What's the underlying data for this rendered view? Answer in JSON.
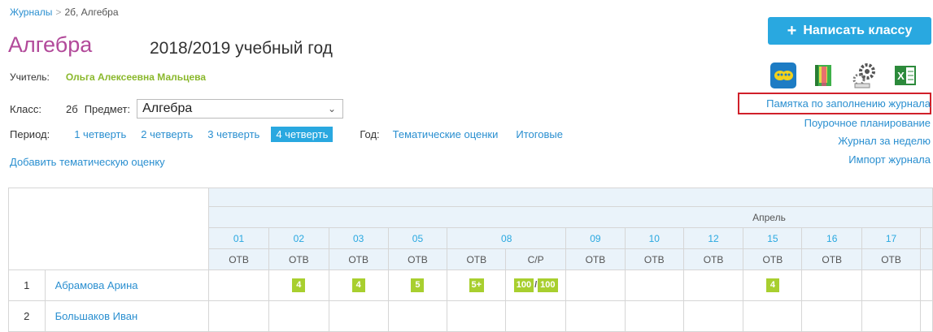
{
  "breadcrumb": {
    "parent": "Журналы",
    "separator": ">",
    "current": "2б, Алгебра"
  },
  "title": {
    "subject": "Алгебра",
    "year": "2018/2019 учебный год"
  },
  "teacher": {
    "label": "Учитель:",
    "name": "Ольга Алексеевна Мальцева"
  },
  "class_row": {
    "class_label": "Класс:",
    "class_value": "2б",
    "subject_label": "Предмет:",
    "subject_value": "Алгебра"
  },
  "period": {
    "label": "Период:",
    "options": [
      "1 четверть",
      "2 четверть",
      "3 четверть",
      "4 четверть"
    ],
    "active_index": 3,
    "year_label": "Год:",
    "year_options": [
      "Тематические оценки",
      "Итоговые"
    ]
  },
  "add_thematic": "Добавить тематическую оценку",
  "write_button": {
    "icon": "+",
    "label": "Написать классу"
  },
  "toolbar_icons": [
    "chat-icon",
    "book-icon",
    "gears-icon",
    "excel-icon",
    "printer-icon"
  ],
  "right_links": [
    "Памятка по заполнению журнала",
    "Поурочное планирование",
    "Журнал за неделю",
    "Импорт журнала"
  ],
  "table": {
    "month": "Апрель",
    "dates": [
      "01",
      "02",
      "03",
      "05",
      "08",
      "09",
      "10",
      "12",
      "15",
      "16",
      "17"
    ],
    "work_types": [
      "ОТВ",
      "ОТВ",
      "ОТВ",
      "ОТВ",
      "ОТВ",
      "С/Р",
      "ОТВ",
      "ОТВ",
      "ОТВ",
      "ОТВ",
      "ОТВ",
      "ОТВ"
    ],
    "students": [
      {
        "num": "1",
        "name": "Абрамова Арина",
        "grades": [
          "",
          "4",
          "4",
          "5",
          "5+",
          "100/100",
          "",
          "",
          "",
          "4",
          "",
          ""
        ]
      },
      {
        "num": "2",
        "name": "Большаков Иван",
        "grades": [
          "",
          "",
          "",
          "",
          "",
          "",
          "",
          "",
          "",
          "",
          "",
          ""
        ]
      }
    ]
  },
  "colors": {
    "accent": "#29a8e0",
    "title": "#b24a9a",
    "teacher": "#8ab82c",
    "badge": "#a8cf2f",
    "highlight": "#d0202a"
  }
}
